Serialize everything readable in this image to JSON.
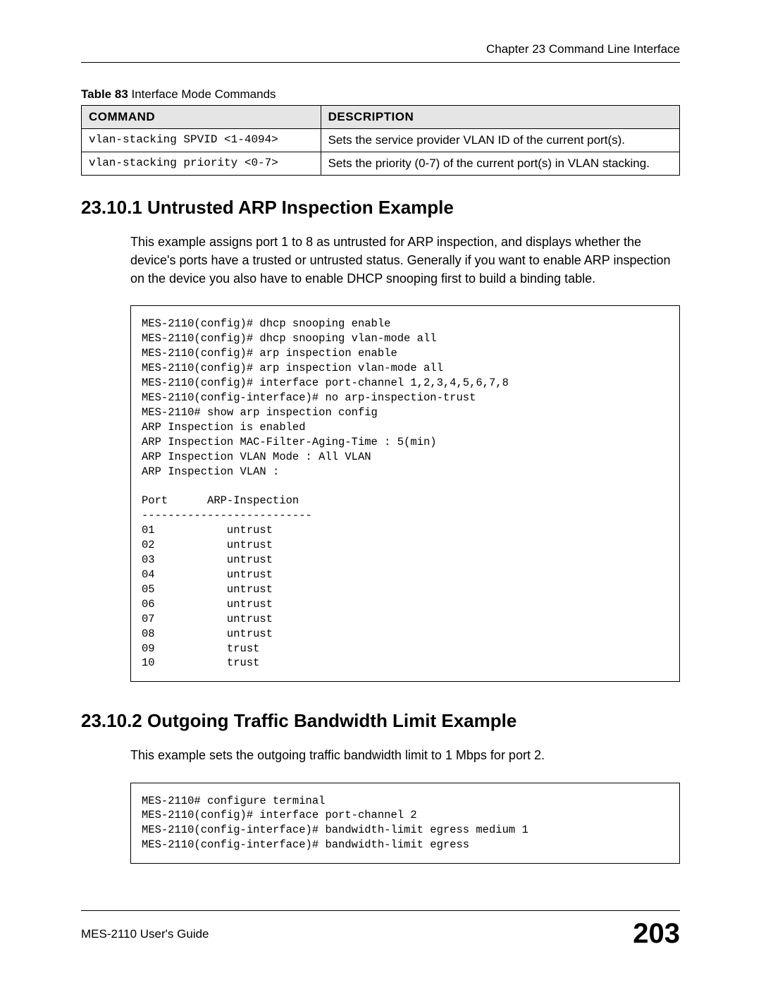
{
  "header": {
    "chapter_text": "Chapter 23 Command Line Interface"
  },
  "table_caption": {
    "label": "Table 83",
    "title": "   Interface Mode Commands"
  },
  "table": {
    "headers": {
      "col1": "Command",
      "col2": "Description"
    },
    "rows": [
      {
        "cmd": "vlan-stacking SPVID <1-4094>",
        "desc": "Sets the service provider VLAN ID of the current port(s)."
      },
      {
        "cmd": "vlan-stacking priority <0-7>",
        "desc": "Sets the priority (0-7) of the current port(s) in VLAN stacking."
      }
    ]
  },
  "section1": {
    "heading": "23.10.1  Untrusted ARP Inspection Example",
    "paragraph": "This example assigns port 1 to 8 as untrusted for ARP inspection, and displays whether the device's ports have a trusted or untrusted status. Generally if you want to enable ARP inspection on the device you also have to enable DHCP snooping first to build a binding table.",
    "code": "MES-2110(config)# dhcp snooping enable\nMES-2110(config)# dhcp snooping vlan-mode all\nMES-2110(config)# arp inspection enable\nMES-2110(config)# arp inspection vlan-mode all\nMES-2110(config)# interface port-channel 1,2,3,4,5,6,7,8\nMES-2110(config-interface)# no arp-inspection-trust\nMES-2110# show arp inspection config\nARP Inspection is enabled\nARP Inspection MAC-Filter-Aging-Time : 5(min)\nARP Inspection VLAN Mode : All VLAN\nARP Inspection VLAN :\n\nPort      ARP-Inspection\n--------------------------\n01           untrust\n02           untrust\n03           untrust\n04           untrust\n05           untrust\n06           untrust\n07           untrust\n08           untrust\n09           trust\n10           trust\n"
  },
  "section2": {
    "heading": "23.10.2  Outgoing Traffic Bandwidth Limit Example",
    "paragraph": "This example sets the outgoing traffic bandwidth limit to 1 Mbps for port 2.",
    "code": "MES-2110# configure terminal\nMES-2110(config)# interface port-channel 2\nMES-2110(config-interface)# bandwidth-limit egress medium 1\nMES-2110(config-interface)# bandwidth-limit egress"
  },
  "footer": {
    "guide": "MES-2110 User's Guide",
    "page": "203"
  }
}
